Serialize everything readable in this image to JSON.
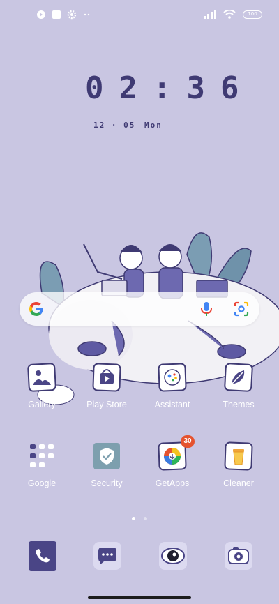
{
  "status_bar": {
    "icons_left": [
      "app-notification-icon",
      "gallery-notification-icon",
      "settings-notification-icon",
      "more-dots-icon"
    ],
    "icons_right": [
      "signal-icon",
      "wifi-icon",
      "battery-icon"
    ],
    "battery_level": "100"
  },
  "clock": {
    "time": "02:36",
    "hour": "02",
    "minute": "36",
    "date": "12 · 05",
    "weekday": "Mon"
  },
  "search": {
    "logo": "google-g-icon",
    "voice": "mic-icon",
    "lens": "google-lens-icon"
  },
  "apps": [
    {
      "label": "Gallery",
      "icon": "gallery-icon"
    },
    {
      "label": "Play Store",
      "icon": "play-store-icon"
    },
    {
      "label": "Assistant",
      "icon": "assistant-icon"
    },
    {
      "label": "Themes",
      "icon": "themes-icon"
    },
    {
      "label": "Google",
      "icon": "google-folder-icon"
    },
    {
      "label": "Security",
      "icon": "security-icon"
    },
    {
      "label": "GetApps",
      "icon": "getapps-icon",
      "badge": "30"
    },
    {
      "label": "Cleaner",
      "icon": "cleaner-icon"
    }
  ],
  "page_indicator": {
    "pages": 2,
    "current": 1
  },
  "dock": [
    {
      "icon": "phone-icon"
    },
    {
      "icon": "messages-icon"
    },
    {
      "icon": "browser-icon"
    },
    {
      "icon": "camera-icon"
    }
  ],
  "colors": {
    "wallpaper": "#c9c6e2",
    "accent": "#4a4586",
    "badge": "#e5532f"
  }
}
